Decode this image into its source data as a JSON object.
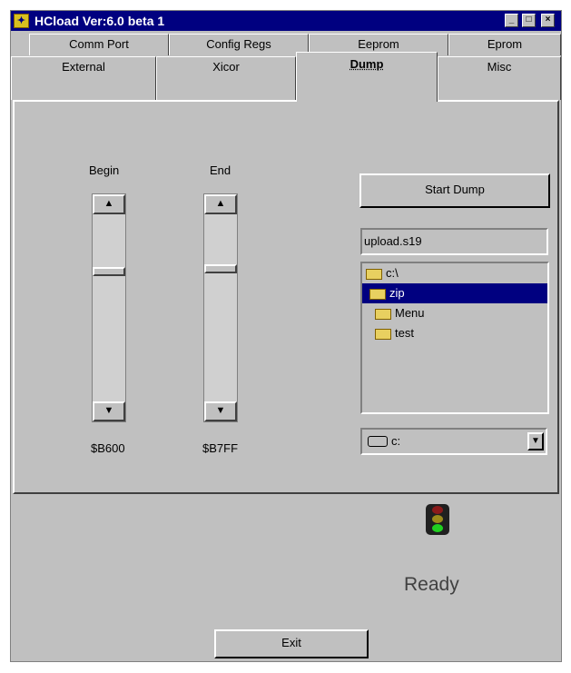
{
  "window": {
    "title": "HCload Ver:6.0 beta 1"
  },
  "titlebar_buttons": {
    "minimize": "_",
    "maximize": "□",
    "close": "×"
  },
  "tabs_row1": [
    "Comm Port",
    "Config Regs",
    "Eeprom",
    "Eprom"
  ],
  "tabs_row2": [
    "External",
    "Xicor",
    "Dump",
    "Misc"
  ],
  "active_tab": "Dump",
  "dump": {
    "begin_label": "Begin",
    "end_label": "End",
    "begin_value": "$B600",
    "end_value": "$B7FF",
    "start_dump_label": "Start Dump",
    "filename_value": "upload.s19",
    "folders": [
      {
        "label": "c:\\",
        "state": "open"
      },
      {
        "label": "zip",
        "state": "open-selected"
      },
      {
        "label": "Menu",
        "state": "closed"
      },
      {
        "label": "test",
        "state": "closed"
      }
    ],
    "drive_value": "c:"
  },
  "status": {
    "text": "Ready"
  },
  "exit_label": "Exit",
  "colors": {
    "titlebar": "#000080",
    "selection": "#000080",
    "face": "#c0c0c0"
  }
}
